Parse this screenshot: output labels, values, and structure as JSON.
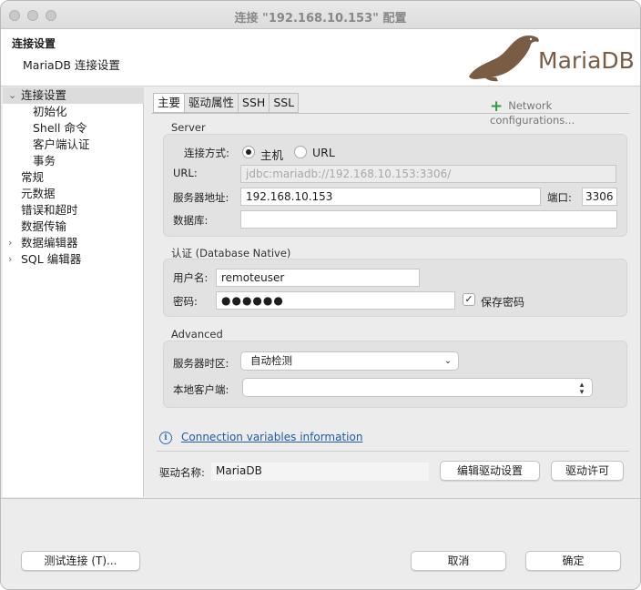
{
  "window": {
    "title": "连接 \"192.168.10.153\" 配置"
  },
  "header": {
    "title": "连接设置",
    "subtitle": "MariaDB 连接设置",
    "logo_text": "MariaDB",
    "logo_color": "#7a5b44"
  },
  "sidebar": {
    "items": [
      {
        "label": "连接设置",
        "selected": true,
        "expandable": true
      },
      {
        "label": "初始化"
      },
      {
        "label": "Shell 命令"
      },
      {
        "label": "客户端认证"
      },
      {
        "label": "事务"
      },
      {
        "label": "常规"
      },
      {
        "label": "元数据"
      },
      {
        "label": "错误和超时"
      },
      {
        "label": "数据传输"
      },
      {
        "label": "数据编辑器",
        "expandable": true
      },
      {
        "label": "SQL 编辑器",
        "expandable": true
      }
    ]
  },
  "tabs": [
    {
      "label": "主要"
    },
    {
      "label": "驱动属性"
    },
    {
      "label": "SSH"
    },
    {
      "label": "SSL"
    }
  ],
  "network_config": {
    "label": "Network configurations..."
  },
  "server": {
    "group_label": "Server",
    "connect_label": "连接方式:",
    "radio_host": "主机",
    "radio_url": "URL",
    "url_label": "URL:",
    "url_value": "jdbc:mariadb://192.168.10.153:3306/",
    "host_label": "服务器地址:",
    "host_value": "192.168.10.153",
    "port_label": "端口:",
    "port_value": "3306",
    "db_label": "数据库:",
    "db_value": ""
  },
  "auth": {
    "group_label": "认证 (Database Native)",
    "user_label": "用户名:",
    "user_value": "remoteuser",
    "pwd_label": "密码:",
    "pwd_value": "●●●●●●",
    "save_pwd_label": "保存密码",
    "save_pwd_checked": true
  },
  "advanced": {
    "group_label": "Advanced",
    "tz_label": "服务器时区:",
    "tz_value": "自动检测",
    "client_label": "本地客户端:",
    "client_value": ""
  },
  "info_link": "Connection variables information",
  "driver": {
    "name_label": "驱动名称:",
    "name_value": "MariaDB",
    "edit_button": "编辑驱动设置",
    "license_button": "驱动许可"
  },
  "footer": {
    "test_button": "测试连接 (T)...",
    "cancel_button": "取消",
    "ok_button": "确定"
  }
}
